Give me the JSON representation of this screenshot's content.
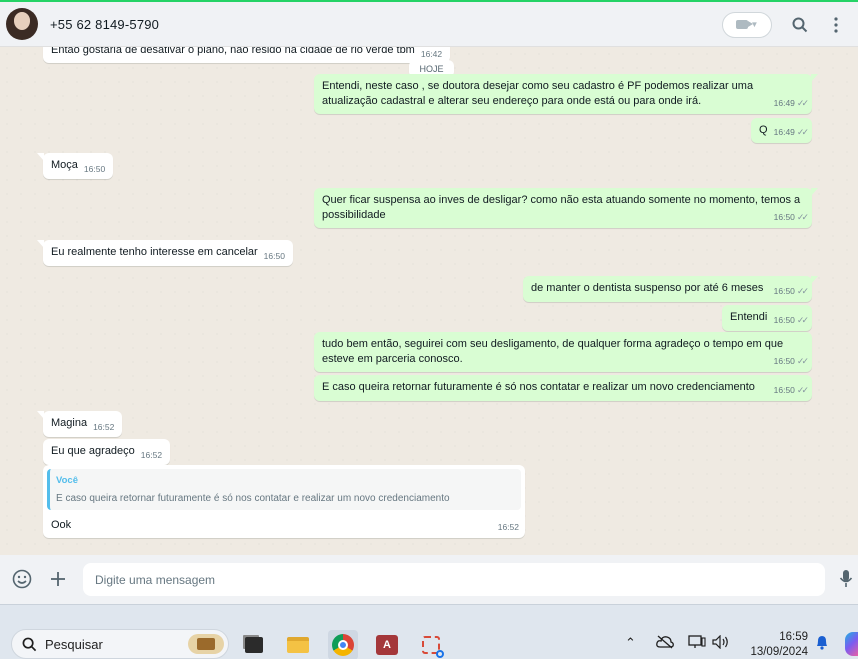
{
  "header": {
    "contact_name": "+55 62 8149-5790",
    "icons": [
      "video-call-icon",
      "search-icon",
      "menu-icon"
    ]
  },
  "chat": {
    "partial_message": {
      "text": "Então gostaria de desativar o plano, não resido na cidade de rio verde tbm",
      "time": "16:42"
    },
    "date_chip": "HOJE",
    "messages": [
      {
        "dir": "out",
        "text": "Entendi, neste caso , se doutora desejar como seu cadastro é PF podemos realizar uma atualização cadastral e alterar seu endereço para onde está ou para onde irá.",
        "time": "16:49"
      },
      {
        "dir": "out",
        "text": "Q",
        "time": "16:49"
      },
      {
        "dir": "in",
        "text": "Moça",
        "time": "16:50"
      },
      {
        "dir": "out",
        "text": "Quer ficar suspensa ao inves de desligar? como não esta atuando somente no momento, temos a possibilidade",
        "time": "16:50"
      },
      {
        "dir": "in",
        "text": "Eu realmente tenho interesse em cancelar",
        "time": "16:50"
      },
      {
        "dir": "out",
        "text": "de manter o dentista suspenso por até 6 meses",
        "time": "16:50"
      },
      {
        "dir": "out",
        "text": "Entendi",
        "time": "16:50"
      },
      {
        "dir": "out",
        "text": "tudo bem então, seguirei com seu desligamento, de qualquer forma agradeço o tempo em que esteve em parceria conosco.",
        "time": "16:50"
      },
      {
        "dir": "out",
        "text": "E caso queira retornar futuramente é só nos contatar e realizar um novo credenciamento",
        "time": "16:50"
      },
      {
        "dir": "in",
        "text": "Magina",
        "time": "16:52"
      },
      {
        "dir": "in",
        "text": "Eu que agradeço",
        "time": "16:52"
      },
      {
        "dir": "in",
        "text": "Ook",
        "time": "16:52",
        "quote": {
          "author": "Você",
          "text": "E caso queira retornar futuramente é só nos contatar e realizar um novo credenciamento"
        }
      }
    ],
    "tick_glyph": "✓✓"
  },
  "composer": {
    "placeholder": "Digite uma mensagem",
    "icons": [
      "emoji-icon",
      "attach-plus-icon",
      "microphone-icon"
    ]
  },
  "taskbar": {
    "search_label": "Pesquisar",
    "apps": [
      "work-briefcase-icon",
      "task-view-icon",
      "file-explorer-icon",
      "chrome-icon",
      "access-icon",
      "snipping-tool-icon"
    ],
    "tray": [
      "chevron-up-icon",
      "cloud-off-icon",
      "display-icon",
      "volume-icon",
      "notification-bell-icon"
    ],
    "time": "16:59",
    "date": "13/09/2024"
  },
  "colors": {
    "incoming_bubble": "#ffffff",
    "outgoing_bubble": "#d9fdd3",
    "chat_background": "#efeae2",
    "header_background": "#f0f2f5",
    "accent": "#25d366",
    "quote_accent": "#53bdeb"
  }
}
